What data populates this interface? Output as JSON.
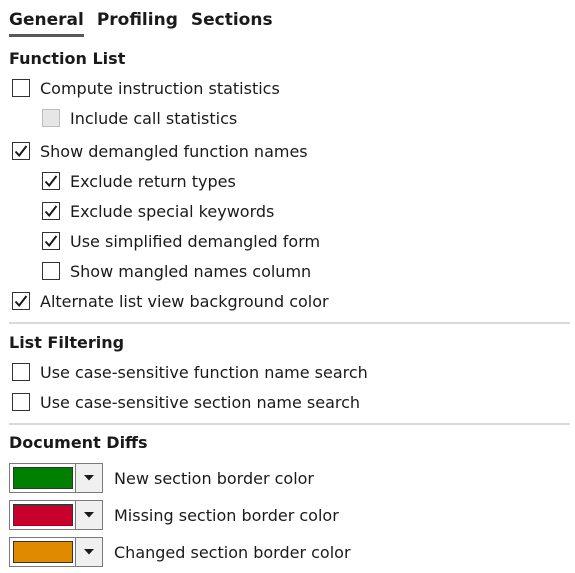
{
  "tabs": [
    {
      "label": "General",
      "active": true
    },
    {
      "label": "Profiling",
      "active": false
    },
    {
      "label": "Sections",
      "active": false
    }
  ],
  "function_list": {
    "title": "Function List",
    "options": [
      {
        "label": "Compute instruction statistics",
        "checked": false,
        "disabled": false,
        "indent": 0
      },
      {
        "label": "Include call statistics",
        "checked": false,
        "disabled": true,
        "indent": 1
      },
      {
        "label": "Show demangled function names",
        "checked": true,
        "disabled": false,
        "indent": 0
      },
      {
        "label": "Exclude return types",
        "checked": true,
        "disabled": false,
        "indent": 1
      },
      {
        "label": "Exclude special keywords",
        "checked": true,
        "disabled": false,
        "indent": 1
      },
      {
        "label": "Use simplified demangled form",
        "checked": true,
        "disabled": false,
        "indent": 1
      },
      {
        "label": "Show mangled names column",
        "checked": false,
        "disabled": false,
        "indent": 1
      },
      {
        "label": "Alternate list view background color",
        "checked": true,
        "disabled": false,
        "indent": 0
      }
    ]
  },
  "list_filtering": {
    "title": "List Filtering",
    "options": [
      {
        "label": "Use case-sensitive function name search",
        "checked": false
      },
      {
        "label": "Use case-sensitive section name search",
        "checked": false
      }
    ]
  },
  "document_diffs": {
    "title": "Document Diffs",
    "colors": [
      {
        "label": "New section border color",
        "color": "#008000"
      },
      {
        "label": "Missing section border color",
        "color": "#C8002C"
      },
      {
        "label": "Changed section border color",
        "color": "#E08A00"
      }
    ]
  },
  "icons": {
    "check": "checkmark-icon",
    "dropdown": "chevron-down-icon"
  }
}
